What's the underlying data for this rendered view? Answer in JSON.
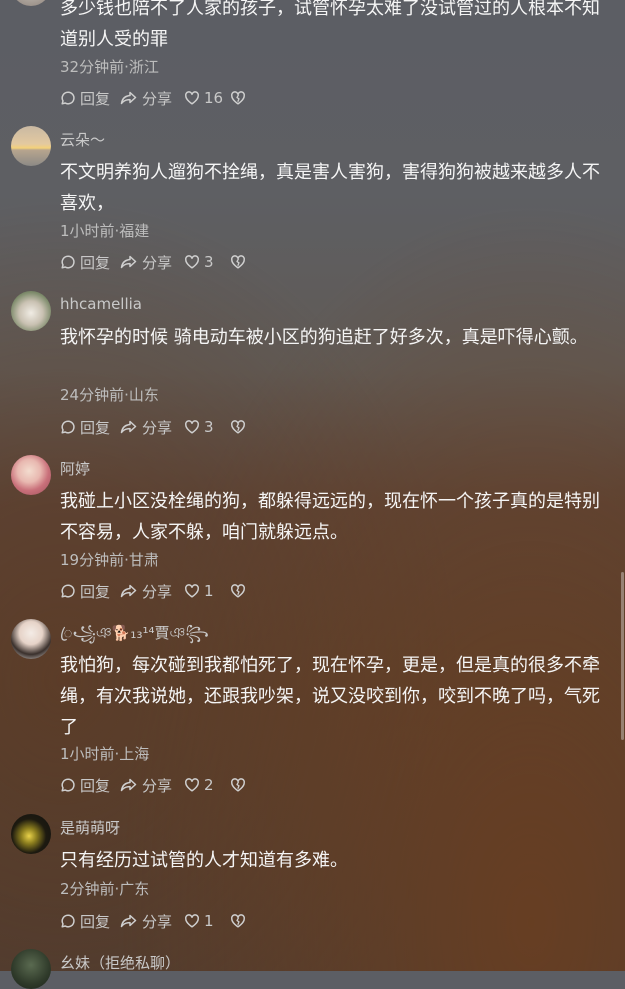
{
  "comments": [
    {
      "nickname": "",
      "text": "多少钱也陪不了人家的孩子，试管怀孕太难了没试管过的人根本不知道别人受的罪",
      "meta": "32分钟前·浙江",
      "reply_label": "回复",
      "share_label": "分享",
      "likes": "16"
    },
    {
      "nickname": "云朵～",
      "text": "不文明养狗人遛狗不拴绳，真是害人害狗，害得狗狗被越来越多人不喜欢，",
      "meta": "1小时前·福建",
      "reply_label": "回复",
      "share_label": "分享",
      "likes": "3"
    },
    {
      "nickname": "hhcamellia",
      "text": "我怀孕的时候 骑电动车被小区的狗追赶了好多次，真是吓得心颤。",
      "meta": "24分钟前·山东",
      "reply_label": "回复",
      "share_label": "分享",
      "likes": "3"
    },
    {
      "nickname": "阿婷",
      "text": "我碰上小区没栓绳的狗，都躲得远远的，现在怀一个孩子真的是特别不容易，人家不躲，咱门就躲远点。",
      "meta": "19分钟前·甘肃",
      "reply_label": "回复",
      "share_label": "分享",
      "likes": "1"
    },
    {
      "nickname": "ꦿ꧁ঞ🐕₁₃¹⁴賈ঞ꧂",
      "text": "我怕狗，每次碰到我都怕死了，现在怀孕，更是，但是真的很多不牵绳，有次我说她，还跟我吵架，说又没咬到你，咬到不晚了吗，气死了",
      "meta": "1小时前·上海",
      "reply_label": "回复",
      "share_label": "分享",
      "likes": "2"
    },
    {
      "nickname": "是萌萌呀",
      "text": "只有经历过试管的人才知道有多难。",
      "meta": "2分钟前·广东",
      "reply_label": "回复",
      "share_label": "分享",
      "likes": "1"
    },
    {
      "nickname": "幺妹（拒绝私聊）",
      "text": "",
      "meta": "",
      "reply_label": "",
      "share_label": "",
      "likes": ""
    }
  ],
  "icons": {
    "reply": "comment-bubble-icon",
    "share": "share-arrow-icon",
    "like": "heart-outline-icon",
    "dislike": "broken-heart-icon"
  }
}
